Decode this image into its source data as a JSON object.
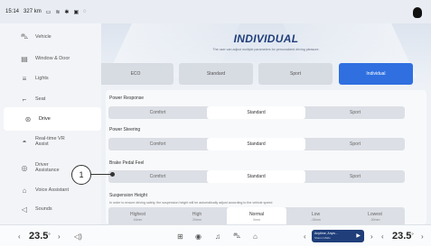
{
  "status": {
    "time": "15:14",
    "range": "327 km"
  },
  "sidebar": {
    "items": [
      {
        "label": "Vehicle",
        "icon": "car-icon"
      },
      {
        "label": "Window & Door",
        "icon": "door-icon"
      },
      {
        "label": "Lights",
        "icon": "light-icon"
      },
      {
        "label": "Seat",
        "icon": "seat-icon"
      },
      {
        "label": "Drive",
        "icon": "steering-wheel-icon",
        "active": true
      },
      {
        "label": "Real-time VR Assist",
        "icon": "vr-assist-icon"
      },
      {
        "label": "Driver Assistance",
        "icon": "driver-assistance-icon"
      },
      {
        "label": "Voice Assistant",
        "icon": "microphone-icon"
      },
      {
        "label": "Sounds",
        "icon": "speaker-icon"
      }
    ]
  },
  "header": {
    "title": "INDIVIDUAL",
    "subtitle": "The user can adjust multiple parameters for personalized driving pleasure."
  },
  "modes": [
    "ECO",
    "Standard",
    "Sport",
    "Individual"
  ],
  "active_mode": "Individual",
  "settings": {
    "power_response": {
      "title": "Power Response",
      "options": [
        "Comfort",
        "Standard",
        "Sport"
      ],
      "selected": "Standard"
    },
    "power_steering": {
      "title": "Power Steering",
      "options": [
        "Comfort",
        "Standard",
        "Sport"
      ],
      "selected": "Standard"
    },
    "brake_pedal_feel": {
      "title": "Brake Pedal Feel",
      "options": [
        "Comfort",
        "Standard",
        "Sport"
      ],
      "selected": "Standard"
    },
    "suspension_height": {
      "title": "Suspension Height",
      "description": "In order to ensure driving safety, the suspension height will be automatically adjust according to the vehicle speed",
      "options": [
        {
          "label": "Highest",
          "sub": "40mm"
        },
        {
          "label": "High",
          "sub": "20mm"
        },
        {
          "label": "Normal",
          "sub": "0mm"
        },
        {
          "label": "Low",
          "sub": "-15mm"
        },
        {
          "label": "Lowest",
          "sub": "-30mm"
        }
      ],
      "selected": "Normal"
    }
  },
  "callout": {
    "number": "1"
  },
  "bottom_bar": {
    "left_temp": "23.5",
    "right_temp": "23.5",
    "temp_unit": "°",
    "media": {
      "title": "Anytime, Anyw...",
      "artist": "Sharon Mallo"
    }
  },
  "colors": {
    "accent": "#2f6fe0",
    "title": "#1f3e7a"
  }
}
